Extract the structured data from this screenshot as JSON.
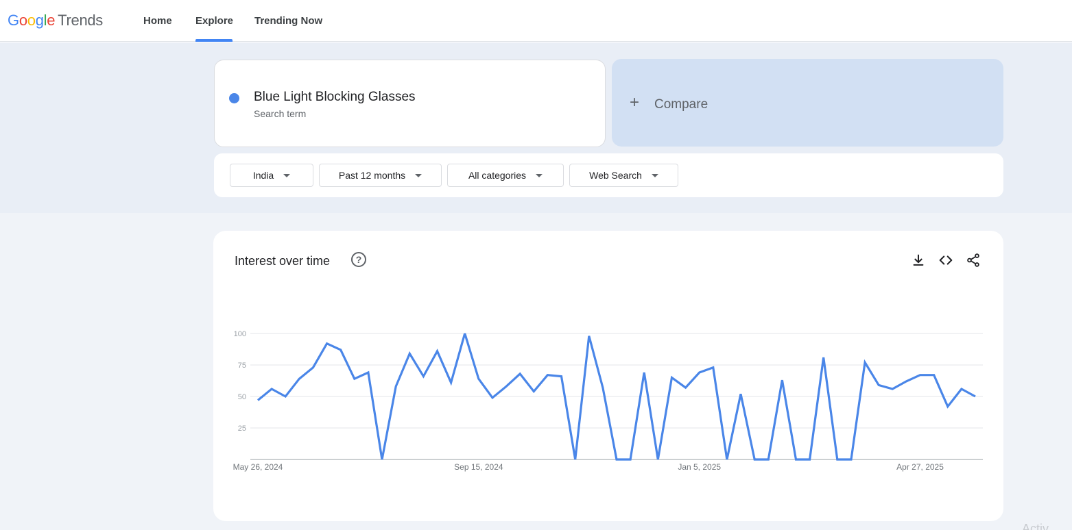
{
  "header": {
    "logo_google": [
      "G",
      "o",
      "o",
      "g",
      "l",
      "e"
    ],
    "logo_trends": "Trends",
    "nav": [
      {
        "label": "Home"
      },
      {
        "label": "Explore"
      },
      {
        "label": "Trending Now"
      }
    ],
    "active_nav": "Explore"
  },
  "search": {
    "term": "Blue Light Blocking Glasses",
    "term_sub": "Search term",
    "term_color": "#4a86e8",
    "compare_label": "Compare"
  },
  "filters": [
    {
      "label": "India"
    },
    {
      "label": "Past 12 months"
    },
    {
      "label": "All categories"
    },
    {
      "label": "Web Search"
    }
  ],
  "panel": {
    "title": "Interest over time",
    "help_glyph": "?",
    "icons": [
      "download-icon",
      "embed-icon",
      "share-icon"
    ]
  },
  "chart_data": {
    "type": "line",
    "title": "Interest over time",
    "series": [
      {
        "name": "Blue Light Blocking Glasses",
        "color": "#4a86e8",
        "values": [
          47,
          56,
          50,
          64,
          73,
          92,
          87,
          64,
          69,
          0,
          58,
          84,
          66,
          86,
          61,
          100,
          64,
          49,
          58,
          68,
          54,
          67,
          66,
          0,
          98,
          57,
          0,
          0,
          69,
          0,
          65,
          57,
          69,
          73,
          0,
          52,
          0,
          0,
          63,
          0,
          0,
          81,
          0,
          0,
          77,
          59,
          56,
          62,
          67,
          67,
          42,
          56,
          50
        ]
      }
    ],
    "x_tick_labels": [
      "May 26, 2024",
      "Sep 15, 2024",
      "Jan 5, 2025",
      "Apr 27, 2025"
    ],
    "x_tick_indices": [
      0,
      16,
      32,
      48
    ],
    "y_ticks": [
      25,
      50,
      75,
      100
    ],
    "ylim": [
      0,
      100
    ],
    "grid": true,
    "legend": "none"
  },
  "corner": {
    "text": "Activ"
  }
}
